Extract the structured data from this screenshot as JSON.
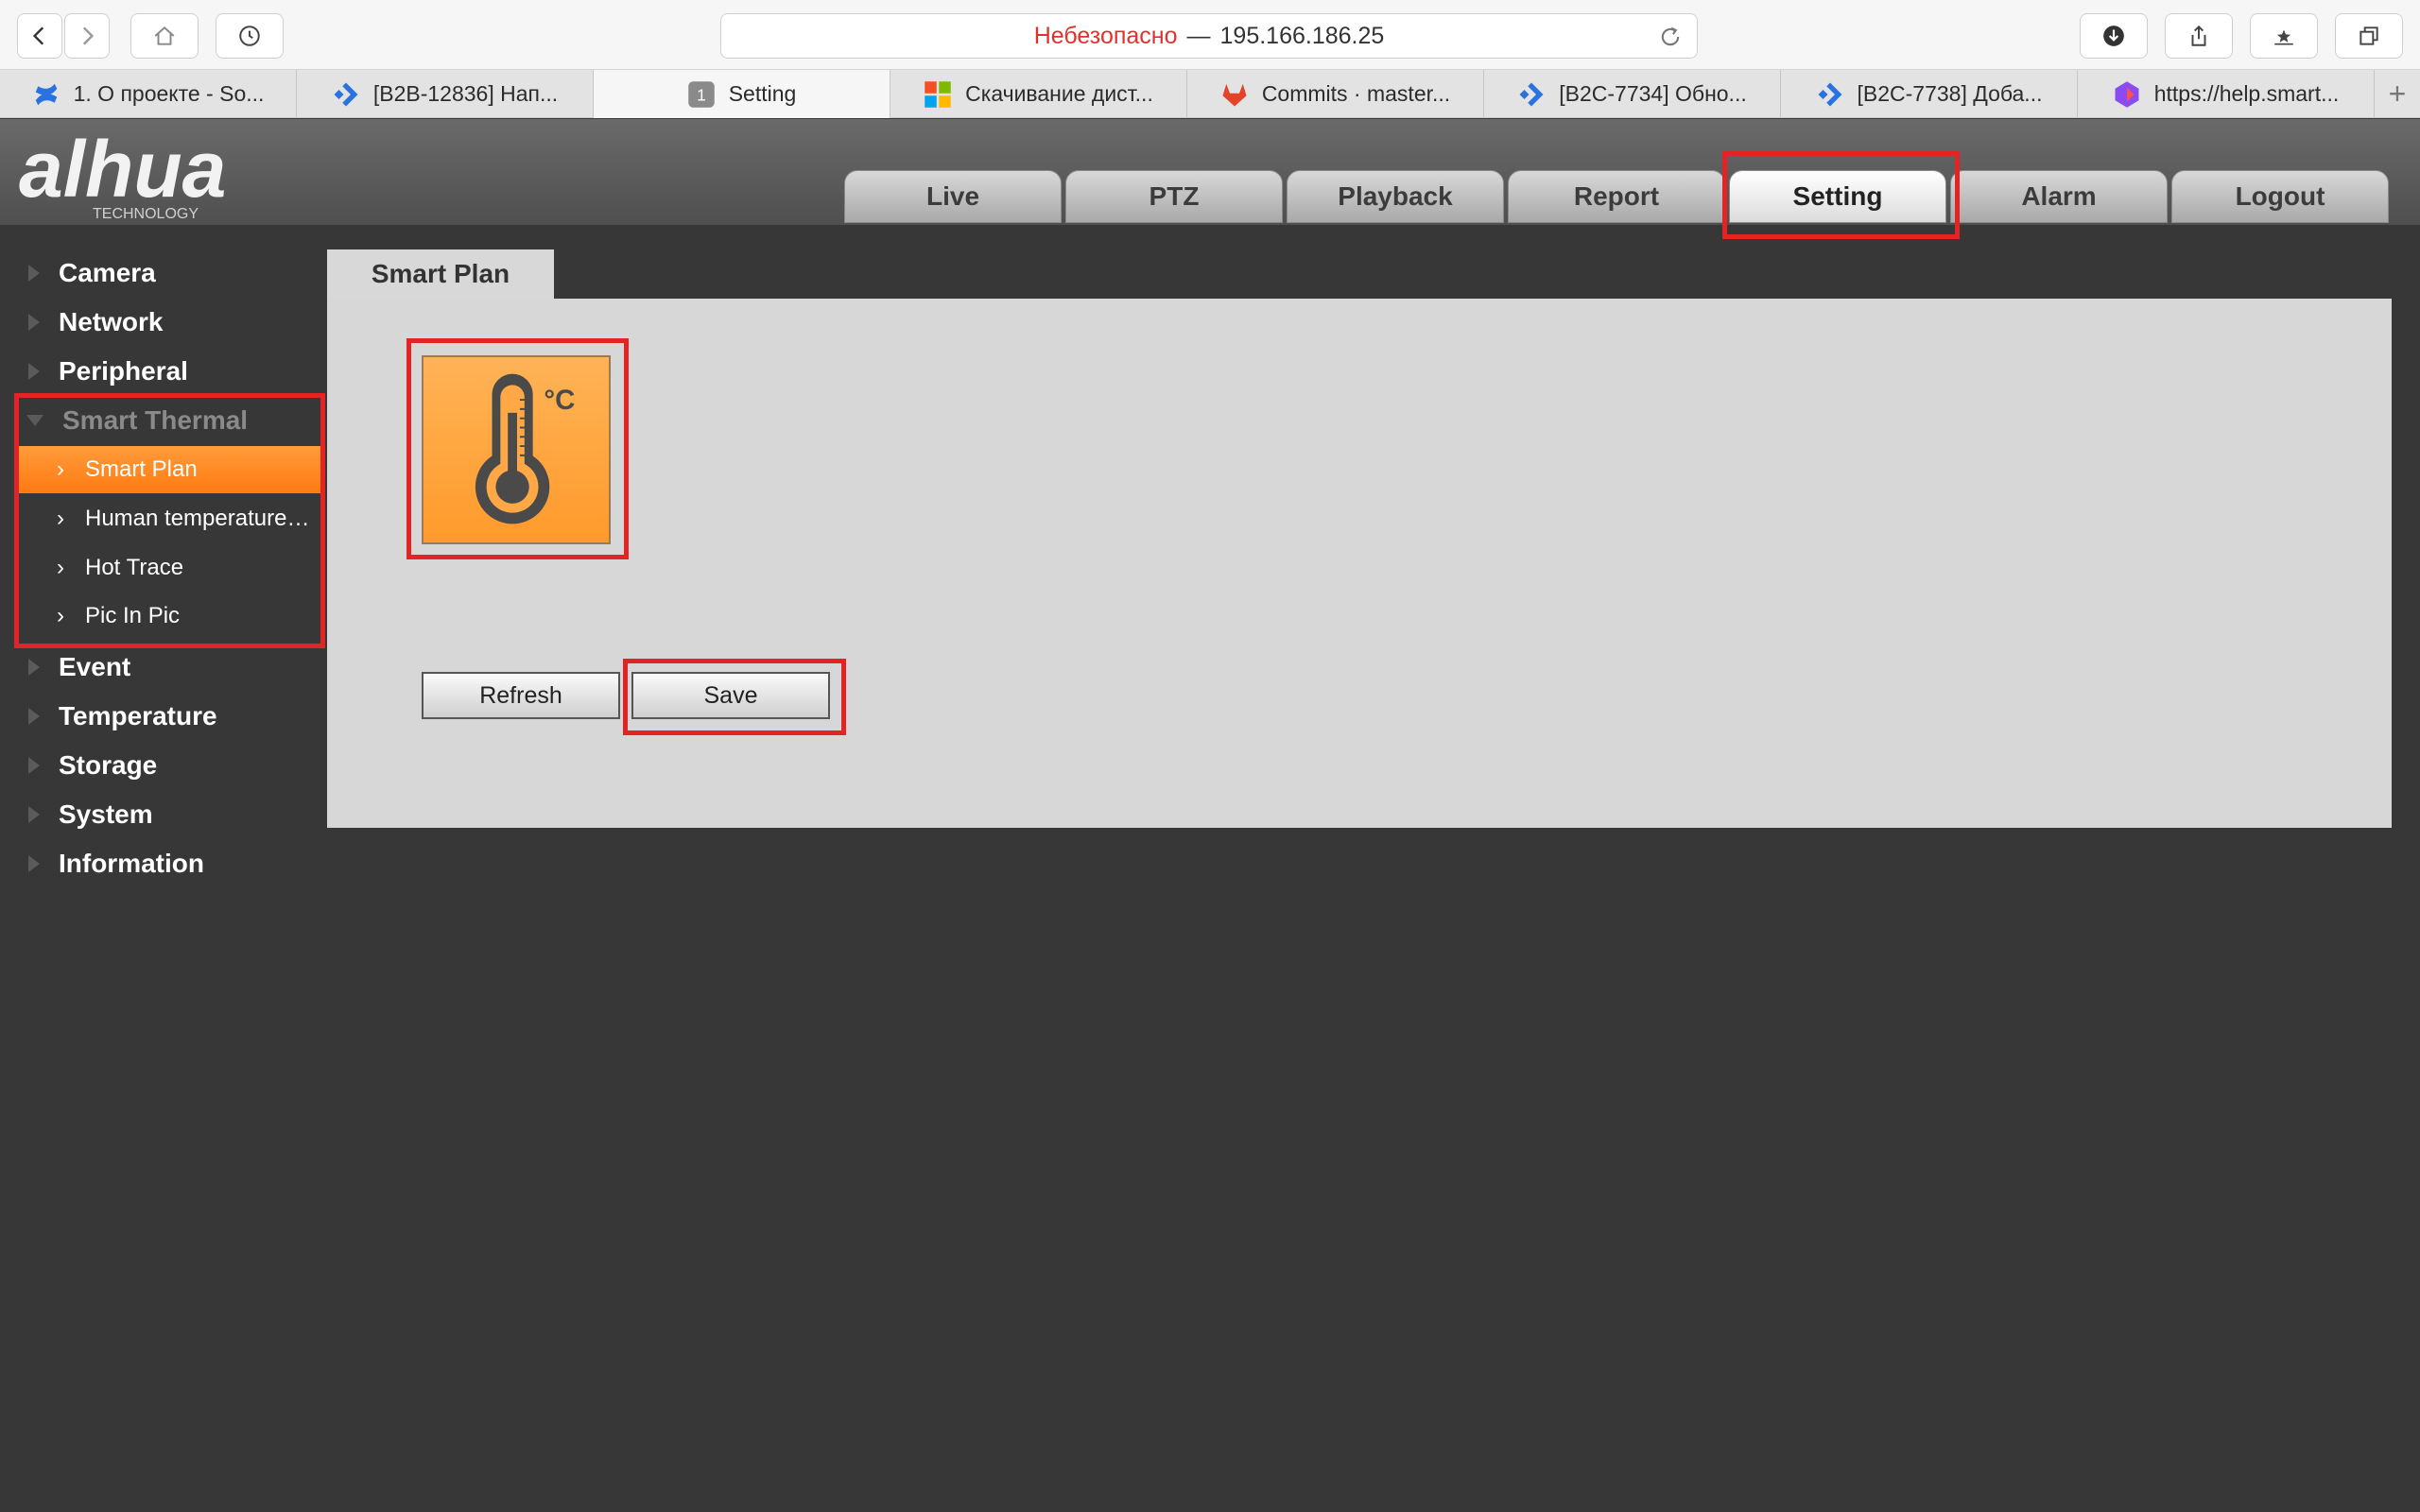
{
  "browser": {
    "url_insecure_label": "Небезопасно",
    "url_separator": "—",
    "url_host": "195.166.186.25",
    "tabs": [
      {
        "label": "1. О проекте - So...",
        "icon": "confluence-icon"
      },
      {
        "label": "[B2B-12836] Нап...",
        "icon": "jira-icon"
      },
      {
        "label": "Setting",
        "icon": "page-number-icon",
        "badge": "1"
      },
      {
        "label": "Скачивание дист...",
        "icon": "microsoft-icon"
      },
      {
        "label": "Commits · master...",
        "icon": "gitlab-icon"
      },
      {
        "label": "[B2C-7734] Обно...",
        "icon": "jira-icon"
      },
      {
        "label": "[B2C-7738] Доба...",
        "icon": "jira-icon"
      },
      {
        "label": "https://help.smart...",
        "icon": "site-icon"
      }
    ],
    "new_tab_label": "+"
  },
  "app": {
    "logo_text": "alhua",
    "logo_sub": "TECHNOLOGY",
    "nav": [
      "Live",
      "PTZ",
      "Playback",
      "Report",
      "Setting",
      "Alarm",
      "Logout"
    ],
    "active_nav": "Setting"
  },
  "sidebar": {
    "sections_top": [
      "Camera",
      "Network",
      "Peripheral"
    ],
    "open_section": "Smart Thermal",
    "sub_items": [
      "Smart Plan",
      "Human temperature ...",
      "Hot Trace",
      "Pic In Pic"
    ],
    "active_sub": "Smart Plan",
    "sections_bottom": [
      "Event",
      "Temperature",
      "Storage",
      "System",
      "Information"
    ]
  },
  "content": {
    "tab_title": "Smart Plan",
    "tile_icon": "thermometer-icon",
    "tile_unit": "°C",
    "refresh_label": "Refresh",
    "save_label": "Save"
  },
  "colors": {
    "highlight": "#e42424",
    "active_orange": "#ff8a20",
    "insecure": "#e0322d"
  }
}
